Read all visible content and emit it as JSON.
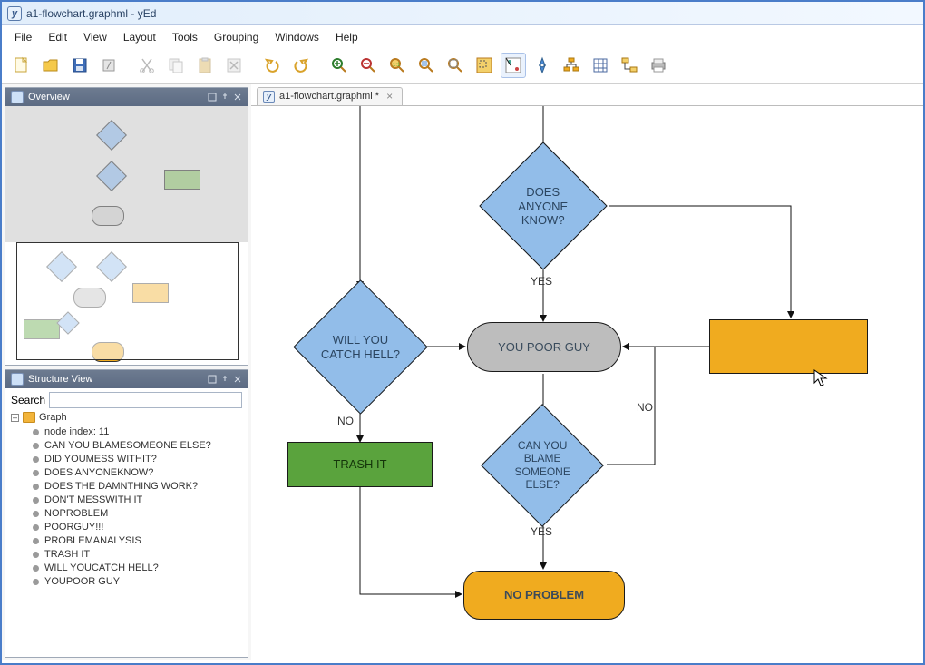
{
  "window": {
    "title": "a1-flowchart.graphml - yEd"
  },
  "menus": {
    "file": "File",
    "edit": "Edit",
    "view": "View",
    "layout": "Layout",
    "tools": "Tools",
    "grouping": "Grouping",
    "windows": "Windows",
    "help": "Help"
  },
  "toolbar": {
    "new_doc": "new-document",
    "open": "open",
    "save": "save",
    "export": "export",
    "cut": "cut",
    "copy": "copy",
    "paste": "paste",
    "delete": "delete",
    "undo": "undo",
    "redo": "redo",
    "zoom_in": "zoom-in",
    "zoom_out": "zoom-out",
    "zoom_1_1": "zoom-1-1",
    "zoom_sel": "zoom-to-selection",
    "zoom_fit": "fit-content",
    "area_zoom": "area-zoom",
    "edit_mode": "edit-mode",
    "nav_mode": "navigation-mode",
    "hierarchy": "hierarchy",
    "grid": "grid",
    "orthogonal": "orthogonal-edges",
    "print": "print"
  },
  "panels": {
    "overview_title": "Overview",
    "structure_title": "Structure View",
    "search_label": "Search",
    "graph_root": "Graph",
    "node_index": "node index: 11",
    "items": [
      "CAN YOU BLAMESOMEONE ELSE?",
      "DID YOUMESS WITHIT?",
      "DOES ANYONEKNOW?",
      "DOES THE DAMNTHING WORK?",
      "DON'T MESSWITH IT",
      "NOPROBLEM",
      "POORGUY!!!",
      "PROBLEMANALYSIS",
      "TRASH IT",
      "WILL YOUCATCH HELL?",
      "YOUPOOR GUY"
    ]
  },
  "tab": {
    "label": "a1-flowchart.graphml *"
  },
  "nodes": {
    "does_anyone_know": "DOES ANYONE KNOW?",
    "will_you_catch_hell": "WILL YOU CATCH HELL?",
    "you_poor_guy": "YOU POOR GUY",
    "trash_it": "TRASH IT",
    "can_you_blame": "CAN YOU BLAME SOMEONE ELSE?",
    "no_problem": "NO PROBLEM"
  },
  "edge_labels": {
    "yes1": "YES",
    "no1": "NO",
    "no2": "NO",
    "yes2": "YES"
  },
  "search": {
    "placeholder": ""
  }
}
